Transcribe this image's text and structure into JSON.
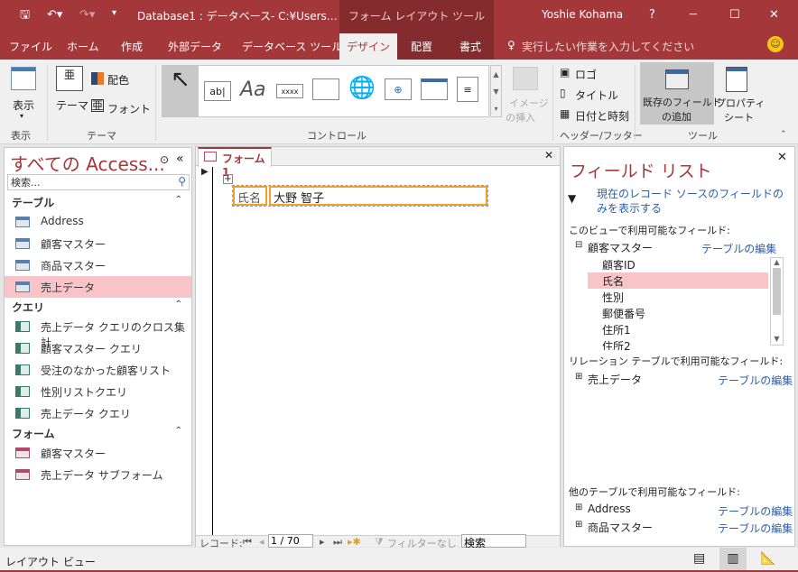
{
  "titlebar": {
    "title": "Database1 : データベース- C:¥Users…",
    "context_tab": "フォーム レイアウト ツール",
    "user": "Yoshie Kohama",
    "help": "?",
    "minimize": "─",
    "maximize": "☐",
    "close": "✕"
  },
  "tabs": [
    "ファイル",
    "ホーム",
    "作成",
    "外部データ",
    "データベース ツール",
    "デザイン",
    "配置",
    "書式"
  ],
  "tell_me": "実行したい作業を入力してください",
  "ribbon": {
    "view": {
      "label": "表示",
      "group": "表示"
    },
    "theme": {
      "themes": "テーマ",
      "colors": "配色",
      "fonts": "フォント",
      "group": "テーマ"
    },
    "controls": {
      "group": "コントロール",
      "textbox": "ab|",
      "label": "Aa",
      "button": "xxxx"
    },
    "image": {
      "label1": "イメージ",
      "label2": "の挿入"
    },
    "header": {
      "logo": "ロゴ",
      "title": "タイトル",
      "datetime": "日付と時刻",
      "group": "ヘッダー/フッター"
    },
    "tools": {
      "add_fields1": "既存のフィールド",
      "add_fields2": "の追加",
      "props1": "プロパティ",
      "props2": "シート",
      "group": "ツール"
    }
  },
  "nav": {
    "title": "すべての Access...",
    "search_placeholder": "検索...",
    "sections": [
      {
        "name": "テーブル",
        "items": [
          "Address",
          "顧客マスター",
          "商品マスター",
          "売上データ"
        ]
      },
      {
        "name": "クエリ",
        "items": [
          "売上データ クエリのクロス集計",
          "顧客マスター クエリ",
          "受注のなかった顧客リスト",
          "性別リストクエリ",
          "売上データ クエリ"
        ]
      },
      {
        "name": "フォーム",
        "items": [
          "顧客マスター",
          "売上データ サブフォーム"
        ]
      }
    ],
    "selected": "売上データ"
  },
  "form": {
    "tab": "フォーム1",
    "field_label": "氏名",
    "field_value": "大野 智子",
    "record_nav": {
      "label": "レコード:",
      "current": "1 / 70",
      "filter": "フィルターなし",
      "search": "検索"
    }
  },
  "field_list": {
    "title": "フィールド リスト",
    "show_only": "現在のレコード ソースのフィールドのみを表示する",
    "available": "このビューで利用可能なフィールド:",
    "table": "顧客マスター",
    "edit": "テーブルの編集",
    "fields": [
      "顧客ID",
      "氏名",
      "性別",
      "郵便番号",
      "住所1",
      "住所2"
    ],
    "selected_field": "氏名",
    "related": "リレーション テーブルで利用可能なフィールド:",
    "related_tables": [
      "売上データ"
    ],
    "other": "他のテーブルで利用可能なフィールド:",
    "other_tables": [
      "Address",
      "商品マスター"
    ]
  },
  "status": {
    "text": "レイアウト ビュー"
  },
  "colors": {
    "accent": "#a4373a",
    "selection": "#f8c4c8",
    "link": "#2a5ea8"
  }
}
